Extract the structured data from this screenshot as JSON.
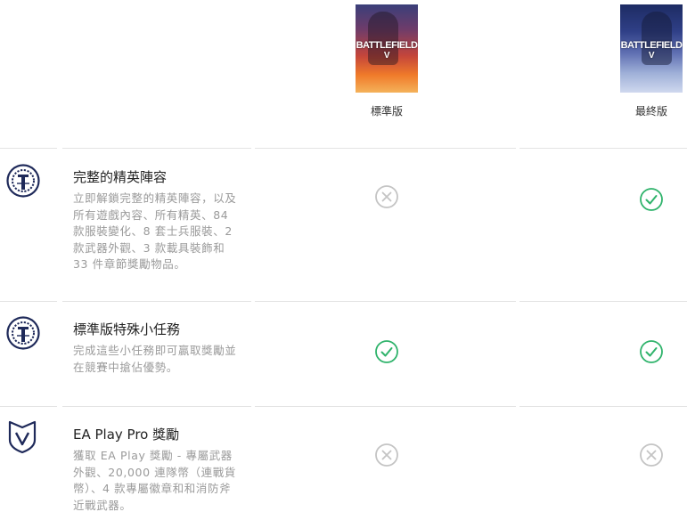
{
  "editions": [
    {
      "label": "標準版",
      "cover_title": "BATTLEFIELD",
      "cover_sub": "V",
      "cover_color": "#c4453b"
    },
    {
      "label": "最終版",
      "cover_title": "BATTLEFIELD",
      "cover_sub": "V",
      "cover_color": "#2f3f86"
    }
  ],
  "features": [
    {
      "title": "完整的精英陣容",
      "description": "立即解鎖完整的精英陣容，以及所有遊戲內容、所有精英、84 款服裝變化、8 套士兵服裝、2 款武器外觀、3 款載具裝飾和 33 件章節獎勵物品。",
      "icon": "eye-emblem-icon",
      "standard": "not-included",
      "ultimate": "included"
    },
    {
      "title": "標準版特殊小任務",
      "description": "完成這些小任務即可贏取獎勵並在競賽中搶佔優勢。",
      "icon": "eye-emblem-icon",
      "standard": "included",
      "ultimate": "included"
    },
    {
      "title": "EA Play Pro 獎勵",
      "description": "獲取 EA Play 獎勵 - 專屬武器外觀、20,000 連隊幣（連戰貨幣）、4 款專屬徽章和和消防斧近戰武器。",
      "icon": "v-shield-icon",
      "standard": "not-included",
      "ultimate": "not-included"
    }
  ],
  "colors": {
    "included": "#2fb36b",
    "not_included": "#c4c4c4",
    "icon_navy": "#1f2a5a"
  }
}
